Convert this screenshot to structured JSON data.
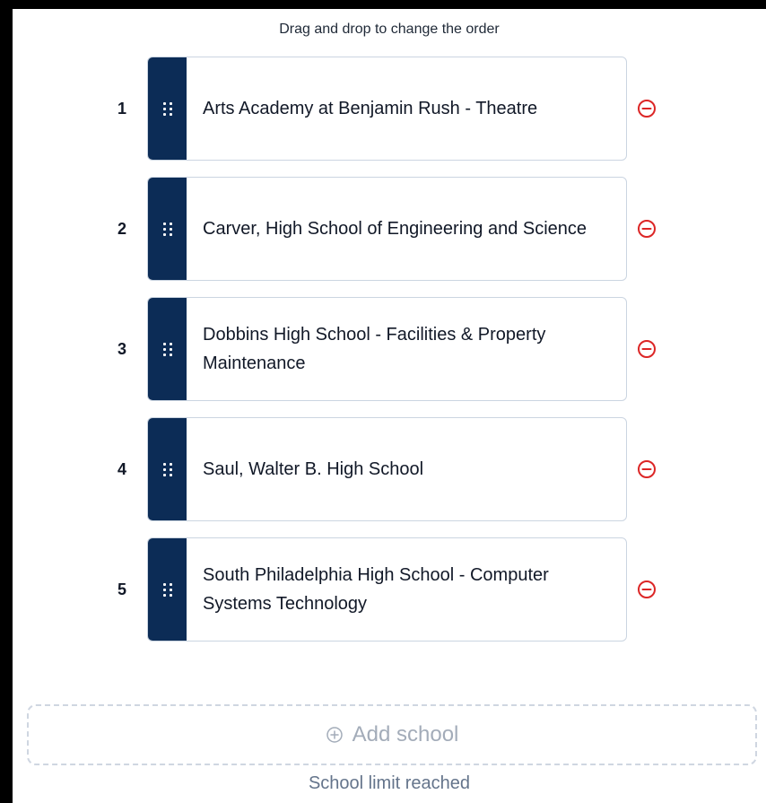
{
  "instructions": "Drag and drop to change the order",
  "schools": [
    {
      "rank": "1",
      "name": "Arts Academy at Benjamin Rush - Theatre"
    },
    {
      "rank": "2",
      "name": "Carver, High School of Engineering and Science"
    },
    {
      "rank": "3",
      "name": "Dobbins High School - Facilities & Property Maintenance"
    },
    {
      "rank": "4",
      "name": "Saul, Walter B. High School"
    },
    {
      "rank": "5",
      "name": "South Philadelphia High School - Computer Systems Technology"
    }
  ],
  "add_button": {
    "label": "Add school",
    "icon": "plus-circle-icon",
    "disabled": true
  },
  "limit_message": "School limit reached",
  "colors": {
    "handle": "#0c2c56",
    "remove": "#dc2626",
    "card_border": "#cbd5e1",
    "muted": "#64748b"
  }
}
